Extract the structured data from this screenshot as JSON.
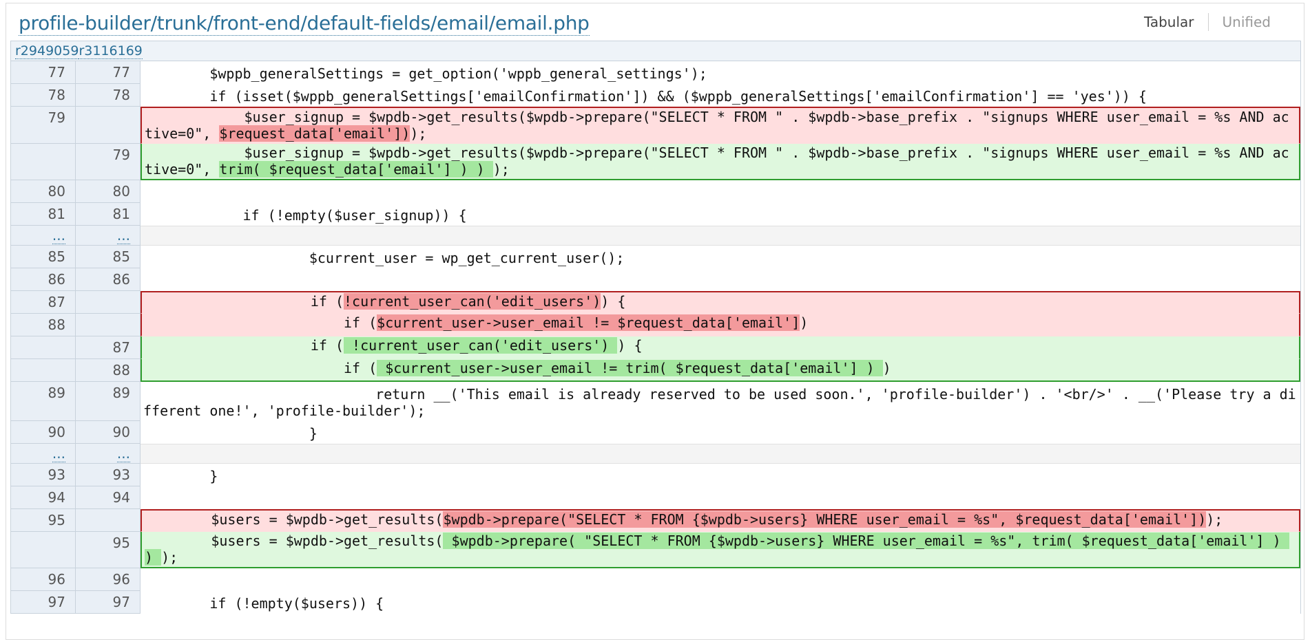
{
  "header": {
    "file_path": "profile-builder/trunk/front-end/default-fields/email/email.php",
    "view_tabular": "Tabular",
    "view_unified": "Unified"
  },
  "revisions": {
    "old": "r2949059",
    "new": "r3116169"
  },
  "skip_marker": "...",
  "lines": {
    "l77_old": "77",
    "l77_new": "77",
    "l77_code": "        $wppb_generalSettings = get_option('wppb_general_settings');",
    "l78_old": "78",
    "l78_new": "78",
    "l78_code": "        if (isset($wppb_generalSettings['emailConfirmation']) && ($wppb_generalSettings['emailConfirmation'] == 'yes')) {",
    "l79d_old": "79",
    "l79d_pre": "            $user_signup = $wpdb->get_results($wpdb->prepare(\"SELECT * FROM \" . $wpdb->base_prefix . \"signups WHERE user_email = %s AND active=0\", ",
    "l79d_hl": "$request_data['email'])",
    "l79d_post": ");",
    "l79a_new": "79",
    "l79a_pre": "            $user_signup = $wpdb->get_results($wpdb->prepare(\"SELECT * FROM \" . $wpdb->base_prefix . \"signups WHERE user_email = %s AND active=0\", ",
    "l79a_hl": "trim( $request_data['email'] ) ) ",
    "l79a_post": ");",
    "l80_old": "80",
    "l80_new": "80",
    "l81_old": "81",
    "l81_new": "81",
    "l81_code": "            if (!empty($user_signup)) {",
    "l85_old": "85",
    "l85_new": "85",
    "l85_code": "                    $current_user = wp_get_current_user();",
    "l86_old": "86",
    "l86_new": "86",
    "l87d_old": "87",
    "l87d_pre": "                    if (",
    "l87d_hl": "!current_user_can('edit_users')",
    "l87d_post": ") {",
    "l88d_old": "88",
    "l88d_pre": "                        if (",
    "l88d_hl": "$current_user->user_email != $request_data['email']",
    "l88d_post": ")",
    "l87a_new": "87",
    "l87a_pre": "                    if (",
    "l87a_hl": " !current_user_can('edit_users') ",
    "l87a_post": ") {",
    "l88a_new": "88",
    "l88a_pre": "                        if (",
    "l88a_hl": " $current_user->user_email != trim( $request_data['email'] ) ",
    "l88a_post": ")",
    "l89_old": "89",
    "l89_new": "89",
    "l89_code": "                            return __('This email is already reserved to be used soon.', 'profile-builder') . '<br/>' . __('Please try a different one!', 'profile-builder');",
    "l90_old": "90",
    "l90_new": "90",
    "l90_code": "                    }",
    "l93_old": "93",
    "l93_new": "93",
    "l93_code": "        }",
    "l94_old": "94",
    "l94_new": "94",
    "l95d_old": "95",
    "l95d_pre": "        $users = $wpdb->get_results(",
    "l95d_hl": "$wpdb->prepare(\"SELECT * FROM {$wpdb->users} WHERE user_email = %s\", $request_data['email'])",
    "l95d_post": ");",
    "l95a_new": "95",
    "l95a_pre": "        $users = $wpdb->get_results(",
    "l95a_hl": " $wpdb->prepare( \"SELECT * FROM {$wpdb->users} WHERE user_email = %s\", trim( $request_data['email'] ) ) ",
    "l95a_post": ");",
    "l96_old": "96",
    "l96_new": "96",
    "l97_old": "97",
    "l97_new": "97",
    "l97_code": "        if (!empty($users)) {"
  }
}
